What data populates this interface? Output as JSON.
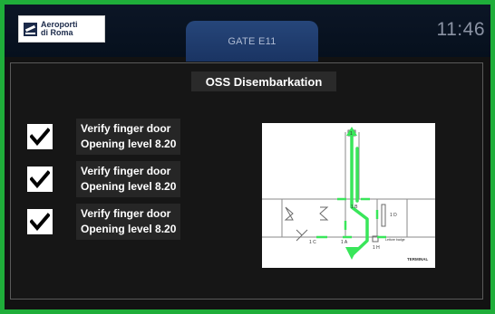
{
  "header": {
    "logo_line1": "Aeroporti",
    "logo_line2": "di Roma",
    "gate_tab": "GATE E11",
    "clock": "11:46"
  },
  "panel": {
    "title": "OSS Disembarkation",
    "checklist": [
      {
        "line1": "Verify finger door",
        "line2": "Opening level 8.20",
        "checked": true
      },
      {
        "line1": "Verify finger door",
        "line2": "Opening level 8.20",
        "checked": true
      },
      {
        "line1": "Verify finger door",
        "line2": "Opening level 8.20",
        "checked": true
      }
    ]
  },
  "map": {
    "labels": {
      "top_marker": "1",
      "door_1b": "1 B",
      "door_1d": "1 D",
      "door_1c": "1 C",
      "door_1a": "1 A",
      "door_1h": "1 H",
      "legend_note": "Lettore badge",
      "terminal": "TERMINAL"
    }
  },
  "colors": {
    "frame_border": "#1fae3a",
    "route_arrow": "#39e65a",
    "gate_tab": "#1f3b6d",
    "background": "#121212"
  }
}
